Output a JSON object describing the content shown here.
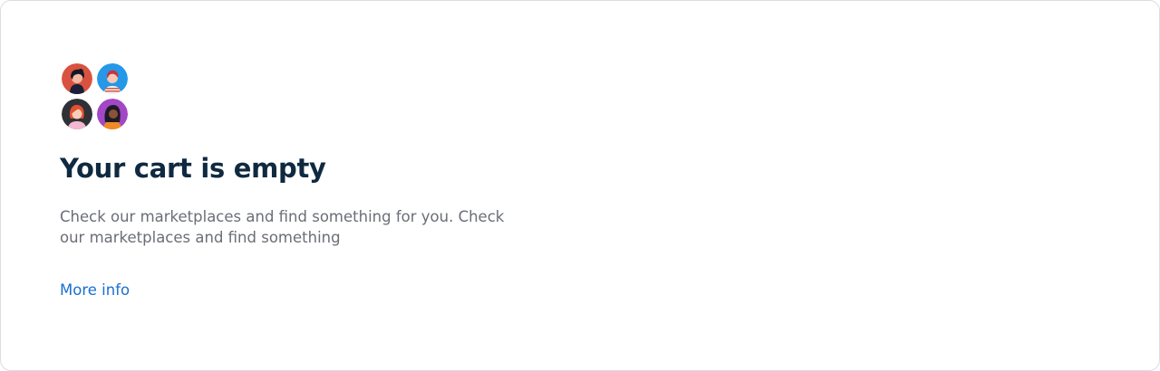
{
  "empty_state": {
    "title": "Your cart is empty",
    "description": "Check our marketplaces and find something for you. Check our marketplaces and find something",
    "link_label": "More info"
  },
  "colors": {
    "title": "#0f2a40",
    "description": "#6a6e76",
    "link": "#1a6fd0",
    "border": "#dadde3"
  },
  "icons": [
    "person-avatar-1-icon",
    "person-avatar-2-icon",
    "person-avatar-3-icon",
    "person-avatar-4-icon"
  ]
}
